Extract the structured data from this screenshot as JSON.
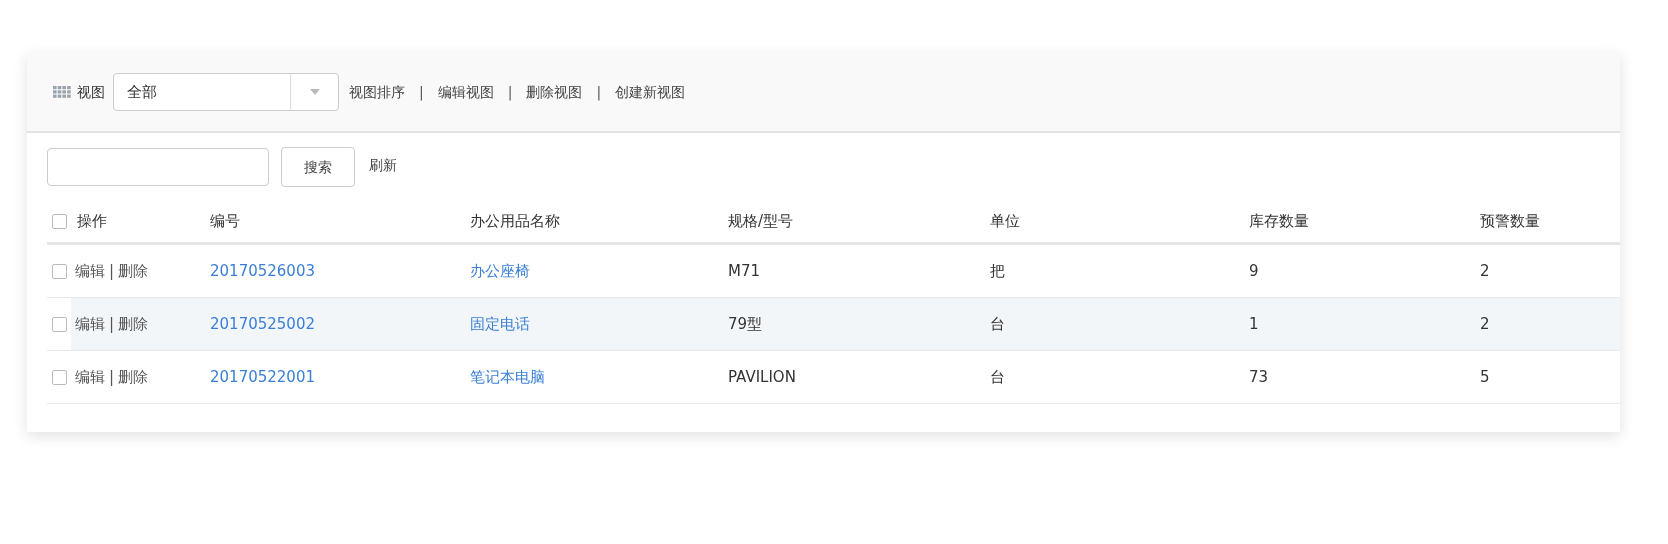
{
  "toolbar": {
    "label": "视图",
    "view_select": {
      "value": "全部"
    },
    "items": [
      {
        "kind": "link",
        "text": "视图排序"
      },
      {
        "kind": "separator",
        "text": "|"
      },
      {
        "kind": "link",
        "text": "编辑视图"
      },
      {
        "kind": "separator",
        "text": "|"
      },
      {
        "kind": "link",
        "text": "删除视图"
      },
      {
        "kind": "separator",
        "text": "|"
      },
      {
        "kind": "link",
        "text": "创建新视图"
      }
    ]
  },
  "search": {
    "button": "搜索",
    "refresh": "刷新"
  },
  "table": {
    "all_checked": false,
    "columns": [
      "操作",
      "编号",
      "办公用品名称",
      "规格/型号",
      "单位",
      "库存数量",
      "预警数量"
    ],
    "rows": [
      {
        "checked": false,
        "highlighted": false,
        "actions": [
          "编辑",
          "|",
          "删除"
        ],
        "code": "20170526003",
        "name": "办公座椅",
        "model": "M71",
        "unit": "把",
        "stock": "9",
        "alert": "2"
      },
      {
        "checked": false,
        "highlighted": true,
        "actions": [
          "编辑",
          "|",
          "删除"
        ],
        "code": "20170525002",
        "name": "固定电话",
        "model": "79型",
        "unit": "台",
        "stock": "1",
        "alert": "2"
      },
      {
        "checked": false,
        "highlighted": false,
        "actions": [
          "编辑",
          "|",
          "删除"
        ],
        "code": "20170522001",
        "name": "笔记本电脑",
        "model": "PAVILION",
        "unit": "台",
        "stock": "73",
        "alert": "5"
      }
    ]
  }
}
